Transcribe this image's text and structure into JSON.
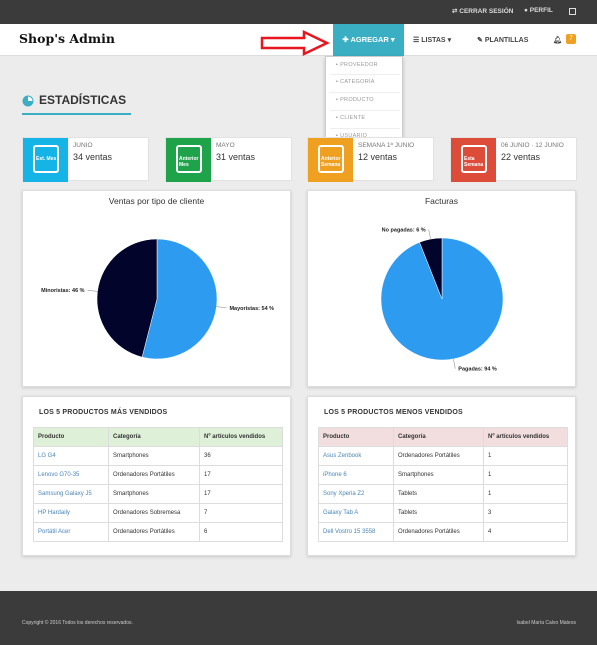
{
  "topbar": {
    "logout": "CERRAR SESIÓN",
    "profile": "PERFIL"
  },
  "navbar": {
    "brand": "Shop's Admin",
    "agregar": "AGREGAR",
    "listas": "LISTAS",
    "plantillas": "PLANTILLAS",
    "notifications": "7"
  },
  "menu": {
    "items": [
      "PROVEEDOR",
      "CATEGORÍA",
      "PRODUCTO",
      "CLIENTE",
      "USUARIO"
    ]
  },
  "section_title": "ESTADÍSTICAS",
  "stats": [
    {
      "icon_label": "Est. Mes",
      "period": "JUNIO",
      "value": "34 ventas",
      "color": "#14b4e6"
    },
    {
      "icon_label": "Anterior Mes",
      "period": "MAYO",
      "value": "31 ventas",
      "color": "#1fa34a"
    },
    {
      "icon_label": "Anterior Semana",
      "period": "SEMANA 1ª JUNIO",
      "value": "12 ventas",
      "color": "#f0a020"
    },
    {
      "icon_label": "Esta Semana",
      "period": "06 JUNIO · 12 JUNIO",
      "value": "22 ventas",
      "color": "#dd4b39"
    }
  ],
  "chart_data": [
    {
      "type": "pie",
      "title": "Ventas por tipo de cliente",
      "labels": [
        "Mayoristas",
        "Minoristas"
      ],
      "values": [
        54,
        46
      ],
      "data_labels": [
        "Mayoristas: 54 %",
        "Minoristas: 46 %"
      ],
      "colors": [
        "#2d9bf0",
        "#03042b"
      ]
    },
    {
      "type": "pie",
      "title": "Facturas",
      "labels": [
        "Pagadas",
        "No pagadas"
      ],
      "values": [
        94,
        6
      ],
      "data_labels": [
        "Pagadas: 94 %",
        "No pagadas: 6 %"
      ],
      "colors": [
        "#2d9bf0",
        "#03042b"
      ]
    }
  ],
  "top_products": {
    "title": "LOS 5 PRODUCTOS MÁS VENDIDOS",
    "header_color": "#dff0d8",
    "headers": [
      "Producto",
      "Categoría",
      "Nº artículos vendidos"
    ],
    "rows": [
      [
        "LG G4",
        "Smartphones",
        "36"
      ],
      [
        "Lenovo G70-35",
        "Ordenadores Portátiles",
        "17"
      ],
      [
        "Samsung Galaxy J5",
        "Smartphones",
        "17"
      ],
      [
        "HP Hardaily",
        "Ordenadores Sobremesa",
        "7"
      ],
      [
        "Portátil Acer",
        "Ordenadores Portátiles",
        "6"
      ]
    ]
  },
  "bottom_products": {
    "title": "LOS 5 PRODUCTOS MENOS VENDIDOS",
    "header_color": "#f2dede",
    "headers": [
      "Producto",
      "Categoría",
      "Nº artículos vendidos"
    ],
    "rows": [
      [
        "Asus Zenbook",
        "Ordenadores Portátiles",
        "1"
      ],
      [
        "iPhone 6",
        "Smartphones",
        "1"
      ],
      [
        "Sony Xperia Z2",
        "Tablets",
        "1"
      ],
      [
        "Galaxy Tab A",
        "Tablets",
        "3"
      ],
      [
        "Dell Vostro 15 3558",
        "Ordenadores Portátiles",
        "4"
      ]
    ]
  },
  "footer": {
    "copyright": "Copyright © 2016 Todos los derechos reservados.",
    "author": "Isabel María Calvo Mateos"
  }
}
